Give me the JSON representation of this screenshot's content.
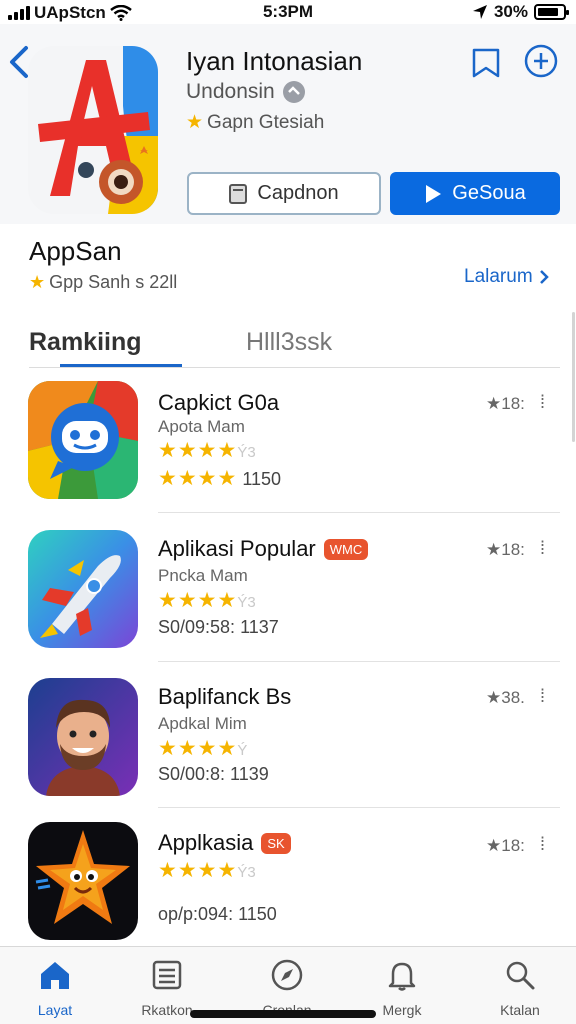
{
  "status_bar": {
    "carrier": "UApStcn",
    "time": "5:3PM",
    "battery_text": "30%",
    "battery_level": 0.85
  },
  "app": {
    "title": "Iyan Intonasian",
    "developer": "Undonsin",
    "rating_text": "Gapn Gtesiah",
    "secondary_button": "Capdnon",
    "primary_button": "GeSoua",
    "icon_colors": {
      "red": "#e8302a",
      "blue": "#2f8de8",
      "yellow": "#f5c400"
    }
  },
  "section": {
    "title": "AppSan",
    "subtitle": "Gpp Sanh s 22ll",
    "see_all": "Lalarum"
  },
  "tabs": [
    {
      "label": "Ramkiing",
      "active": true
    },
    {
      "label": "Hlll3ssk",
      "active": false
    }
  ],
  "rows": [
    {
      "title": "Capkict G0a",
      "badge": "",
      "subtitle": "Apota Mam",
      "stars": 4,
      "stars_half": "Ý3",
      "meta": "1150",
      "meta_prefix_stars": 4,
      "count": "★18:",
      "more": "⁞",
      "icon": "chat-bot-icon"
    },
    {
      "title": "Aplikasi Popular",
      "badge": "WMC",
      "subtitle": "Pncka Mam",
      "stars": 4,
      "stars_half": "Ý3",
      "meta": "S0/09:58: 1137",
      "count": "★18:",
      "more": "⁞",
      "icon": "rocket-icon"
    },
    {
      "title": "Baplifanck Bs",
      "badge": "",
      "subtitle": "Apdkal Mim",
      "stars": 4,
      "stars_half": "Ý",
      "meta": "S0/00:8: 1139",
      "count": "★38.",
      "more": "⁞",
      "icon": "avatar-man-icon"
    },
    {
      "title": "Applkasia",
      "badge": "SK",
      "subtitle": "",
      "stars": 4,
      "stars_half": "Ý3",
      "meta": "op/p:094: 1150",
      "count": "★18:",
      "more": "⁞",
      "icon": "star-creature-icon"
    }
  ],
  "tabbar": [
    {
      "label": "Layat",
      "icon": "home-icon",
      "active": true
    },
    {
      "label": "Rkatkon",
      "icon": "list-icon",
      "active": false
    },
    {
      "label": "Cronlan",
      "icon": "compass-icon",
      "active": false
    },
    {
      "label": "Mergk",
      "icon": "bell-icon",
      "active": false
    },
    {
      "label": "Ktalan",
      "icon": "search-icon",
      "active": false
    }
  ],
  "colors": {
    "accent": "#1a66c9",
    "primary_button": "#0a6ae0",
    "star": "#f5b400",
    "badge": "#e8542e"
  }
}
